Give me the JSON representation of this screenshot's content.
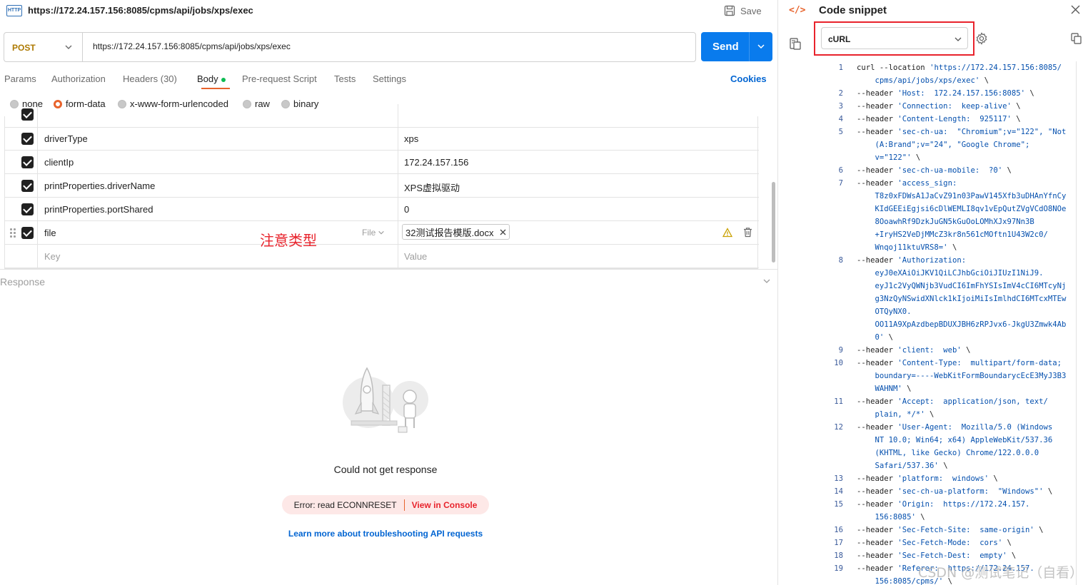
{
  "title_url": "https://172.24.157.156:8085/cpms/api/jobs/xps/exec",
  "save_label": "Save",
  "request": {
    "method": "POST",
    "url": "https://172.24.157.156:8085/cpms/api/jobs/xps/exec",
    "send_label": "Send"
  },
  "tabs": [
    "Params",
    "Authorization",
    "Headers (30)",
    "Body",
    "Pre-request Script",
    "Tests",
    "Settings"
  ],
  "cookies_label": "Cookies",
  "body_types": [
    {
      "label": "none",
      "selected": false
    },
    {
      "label": "form-data",
      "selected": true
    },
    {
      "label": "x-www-form-urlencoded",
      "selected": false
    },
    {
      "label": "raw",
      "selected": false
    },
    {
      "label": "binary",
      "selected": false
    }
  ],
  "form_rows": [
    {
      "key": "driverType",
      "value": "xps"
    },
    {
      "key": "clientIp",
      "value": "172.24.157.156"
    },
    {
      "key": "printProperties.driverName",
      "value": "XPS虚拟驱动"
    },
    {
      "key": "printProperties.portShared",
      "value": "0"
    },
    {
      "key": "file",
      "type": "File",
      "value": "32测试报告模版.docx"
    }
  ],
  "new_row": {
    "key_placeholder": "Key",
    "value_placeholder": "Value"
  },
  "annotation": "注意类型",
  "response": {
    "label": "Response",
    "message": "Could not get response",
    "error": "Error: read ECONNRESET",
    "console_link": "View in Console",
    "learn_link": "Learn more about troubleshooting API requests"
  },
  "snippet": {
    "title": "Code snippet",
    "language": "cURL",
    "lines": [
      {
        "n": "1",
        "segs": [
          [
            "curl --location ",
            0
          ],
          [
            "'https://172.24.157.156:8085/",
            1
          ]
        ]
      },
      {
        "n": "",
        "segs": [
          [
            "    cpms/api/jobs/xps/exec'",
            1
          ],
          [
            " \\",
            0
          ]
        ]
      },
      {
        "n": "2",
        "segs": [
          [
            "--header ",
            0
          ],
          [
            "'Host:  172.24.157.156:8085'",
            1
          ],
          [
            " \\",
            0
          ]
        ]
      },
      {
        "n": "3",
        "segs": [
          [
            "--header ",
            0
          ],
          [
            "'Connection:  keep-alive'",
            1
          ],
          [
            " \\",
            0
          ]
        ]
      },
      {
        "n": "4",
        "segs": [
          [
            "--header ",
            0
          ],
          [
            "'Content-Length:  925117'",
            1
          ],
          [
            " \\",
            0
          ]
        ]
      },
      {
        "n": "5",
        "segs": [
          [
            "--header ",
            0
          ],
          [
            "'sec-ch-ua:  \"Chromium\";v=\"122\", \"Not",
            1
          ]
        ]
      },
      {
        "n": "",
        "segs": [
          [
            "    (A:Brand\";v=\"24\", \"Google Chrome\";",
            1
          ]
        ]
      },
      {
        "n": "",
        "segs": [
          [
            "    v=\"122\"'",
            1
          ],
          [
            " \\",
            0
          ]
        ]
      },
      {
        "n": "6",
        "segs": [
          [
            "--header ",
            0
          ],
          [
            "'sec-ch-ua-mobile:  ?0'",
            1
          ],
          [
            " \\",
            0
          ]
        ]
      },
      {
        "n": "7",
        "segs": [
          [
            "--header ",
            0
          ],
          [
            "'access_sign:",
            1
          ]
        ]
      },
      {
        "n": "",
        "segs": [
          [
            "    T8z0xFDWsA1JaCvZ91n03PawV145Xfb3uDHAnYfnCy",
            1
          ]
        ]
      },
      {
        "n": "",
        "segs": [
          [
            "    KIdGEEiEgjsi6cDlWEMLI8qv1vEpQutZVgVCdO8NOe",
            1
          ]
        ]
      },
      {
        "n": "",
        "segs": [
          [
            "    8OoawhRf9DzkJuGN5kGuOoLOMhXJx97Nn3B",
            1
          ]
        ]
      },
      {
        "n": "",
        "segs": [
          [
            "    +IryHS2VeDjMMcZ3kr8n561cMOftn1U43W2c0/",
            1
          ]
        ]
      },
      {
        "n": "",
        "segs": [
          [
            "    Wnqoj11ktuVRS8='",
            1
          ],
          [
            " \\",
            0
          ]
        ]
      },
      {
        "n": "8",
        "segs": [
          [
            "--header ",
            0
          ],
          [
            "'Authorization:",
            1
          ]
        ]
      },
      {
        "n": "",
        "segs": [
          [
            "    eyJ0eXAiOiJKV1QiLCJhbGciOiJIUzI1NiJ9.",
            1
          ]
        ]
      },
      {
        "n": "",
        "segs": [
          [
            "    eyJ1c2VyQWNjb3VudCI6ImFhYSIsImV4cCI6MTcyNj",
            1
          ]
        ]
      },
      {
        "n": "",
        "segs": [
          [
            "    g3NzQyNSwidXNlck1kIjoiMiIsImlhdCI6MTcxMTEw",
            1
          ]
        ]
      },
      {
        "n": "",
        "segs": [
          [
            "    OTQyNX0.",
            1
          ]
        ]
      },
      {
        "n": "",
        "segs": [
          [
            "    OO11A9XpAzdbepBDUXJBH6zRPJvx6-JkgU3Zmwk4Ab",
            1
          ]
        ]
      },
      {
        "n": "",
        "segs": [
          [
            "    0'",
            1
          ],
          [
            " \\",
            0
          ]
        ]
      },
      {
        "n": "9",
        "segs": [
          [
            "--header ",
            0
          ],
          [
            "'client:  web'",
            1
          ],
          [
            " \\",
            0
          ]
        ]
      },
      {
        "n": "10",
        "segs": [
          [
            "--header ",
            0
          ],
          [
            "'Content-Type:  multipart/form-data;",
            1
          ]
        ]
      },
      {
        "n": "",
        "segs": [
          [
            "    boundary=----WebKitFormBoundarycEcE3MyJ3B3",
            1
          ]
        ]
      },
      {
        "n": "",
        "segs": [
          [
            "    WAHNM'",
            1
          ],
          [
            " \\",
            0
          ]
        ]
      },
      {
        "n": "11",
        "segs": [
          [
            "--header ",
            0
          ],
          [
            "'Accept:  application/json, text/",
            1
          ]
        ]
      },
      {
        "n": "",
        "segs": [
          [
            "    plain, */*'",
            1
          ],
          [
            " \\",
            0
          ]
        ]
      },
      {
        "n": "12",
        "segs": [
          [
            "--header ",
            0
          ],
          [
            "'User-Agent:  Mozilla/5.0 (Windows",
            1
          ]
        ]
      },
      {
        "n": "",
        "segs": [
          [
            "    NT 10.0; Win64; x64) AppleWebKit/537.36",
            1
          ]
        ]
      },
      {
        "n": "",
        "segs": [
          [
            "    (KHTML, like Gecko) Chrome/122.0.0.0",
            1
          ]
        ]
      },
      {
        "n": "",
        "segs": [
          [
            "    Safari/537.36'",
            1
          ],
          [
            " \\",
            0
          ]
        ]
      },
      {
        "n": "13",
        "segs": [
          [
            "--header ",
            0
          ],
          [
            "'platform:  windows'",
            1
          ],
          [
            " \\",
            0
          ]
        ]
      },
      {
        "n": "14",
        "segs": [
          [
            "--header ",
            0
          ],
          [
            "'sec-ch-ua-platform:  \"Windows\"'",
            1
          ],
          [
            " \\",
            0
          ]
        ]
      },
      {
        "n": "15",
        "segs": [
          [
            "--header ",
            0
          ],
          [
            "'Origin:  https://172.24.157.",
            1
          ]
        ]
      },
      {
        "n": "",
        "segs": [
          [
            "    156:8085'",
            1
          ],
          [
            " \\",
            0
          ]
        ]
      },
      {
        "n": "16",
        "segs": [
          [
            "--header ",
            0
          ],
          [
            "'Sec-Fetch-Site:  same-origin'",
            1
          ],
          [
            " \\",
            0
          ]
        ]
      },
      {
        "n": "17",
        "segs": [
          [
            "--header ",
            0
          ],
          [
            "'Sec-Fetch-Mode:  cors'",
            1
          ],
          [
            " \\",
            0
          ]
        ]
      },
      {
        "n": "18",
        "segs": [
          [
            "--header ",
            0
          ],
          [
            "'Sec-Fetch-Dest:  empty'",
            1
          ],
          [
            " \\",
            0
          ]
        ]
      },
      {
        "n": "19",
        "segs": [
          [
            "--header ",
            0
          ],
          [
            "'Referer:  https://172.24.157.",
            1
          ]
        ]
      },
      {
        "n": "",
        "segs": [
          [
            "    156:8085/cpms/'",
            1
          ],
          [
            " \\",
            0
          ]
        ]
      }
    ]
  },
  "watermark": "CSDN @测试笔记（自看）",
  "colors": {
    "accent": "#e8632c",
    "send": "#097bed",
    "link": "#0265d2",
    "method": "#ad7a03",
    "highlight": "#e8232c"
  }
}
